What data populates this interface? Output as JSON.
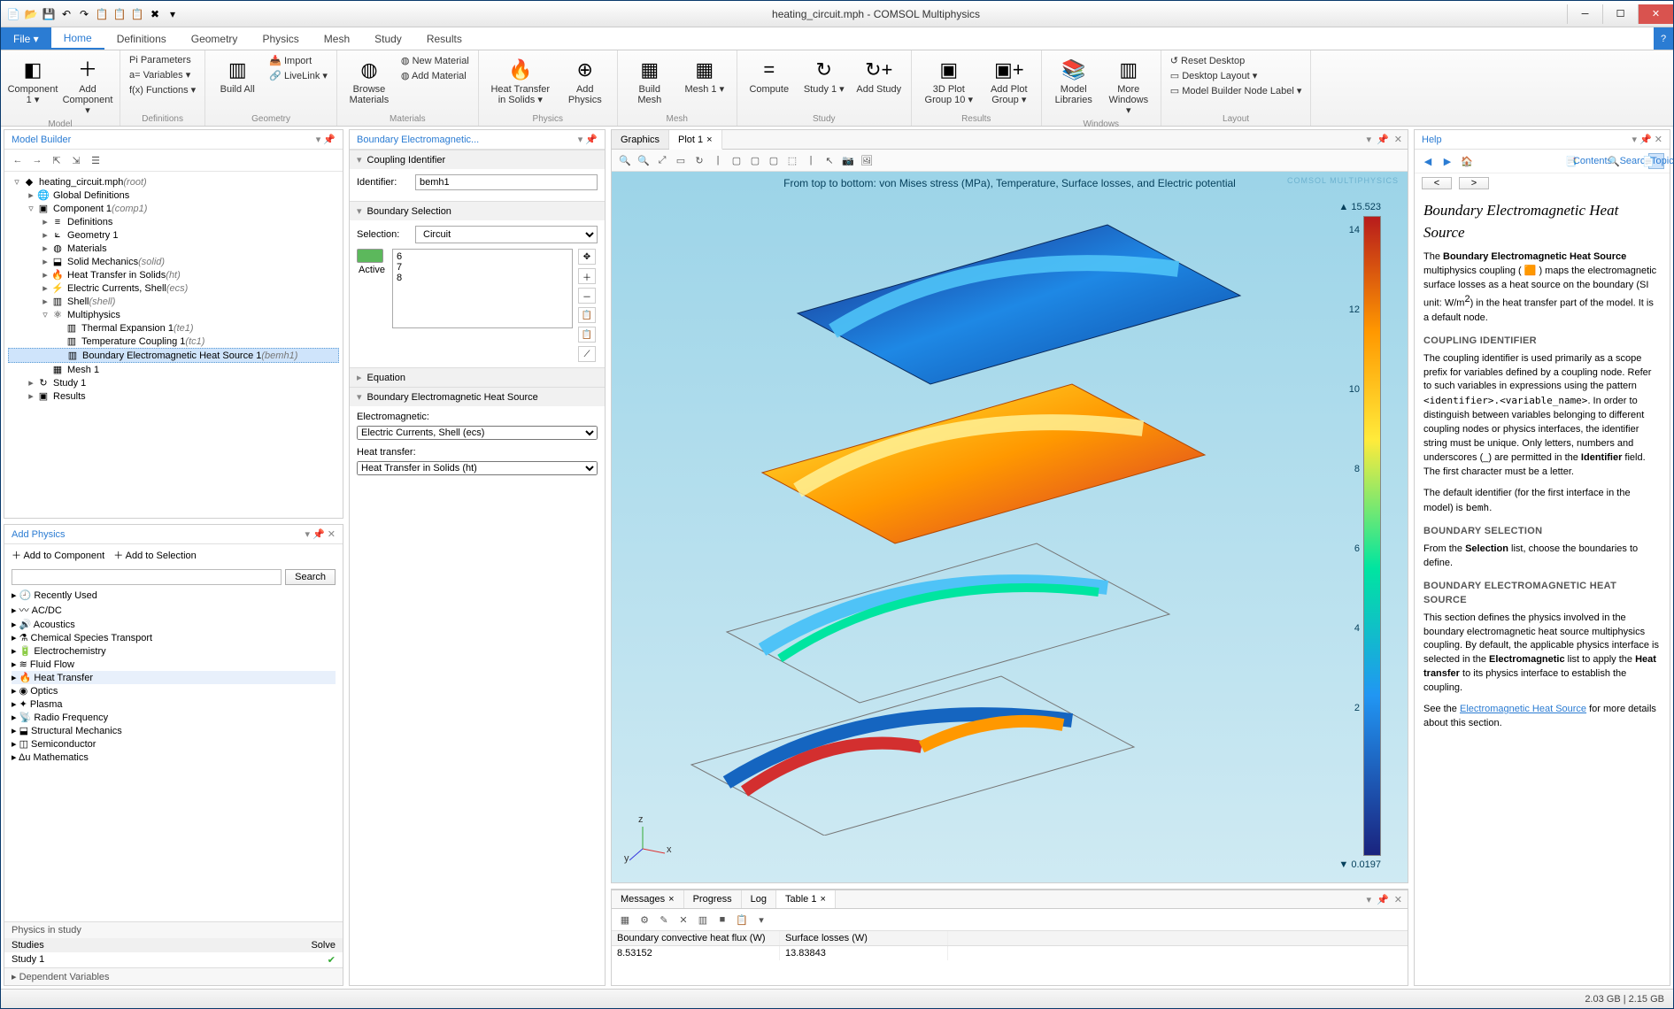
{
  "window": {
    "title": "heating_circuit.mph - COMSOL Multiphysics"
  },
  "qat": [
    "📄",
    "📂",
    "💾",
    "↶",
    "↷",
    "📋",
    "📋",
    "📋",
    "✖",
    "▾"
  ],
  "ribbon": {
    "file": "File ▾",
    "tabs": [
      "Home",
      "Definitions",
      "Geometry",
      "Physics",
      "Mesh",
      "Study",
      "Results"
    ],
    "groups": {
      "model": {
        "label": "Model",
        "btns": [
          {
            "lbl": "Component\n1 ▾",
            "ico": "◧"
          },
          {
            "lbl": "Add\nComponent ▾",
            "ico": "＋"
          }
        ]
      },
      "definitions": {
        "label": "Definitions",
        "stack": [
          "Pi Parameters",
          "a= Variables ▾",
          "f(x) Functions ▾"
        ]
      },
      "geometry": {
        "label": "Geometry",
        "btns": [
          {
            "lbl": "Build\nAll",
            "ico": "▥"
          }
        ],
        "stack": [
          "📥 Import",
          "🔗 LiveLink ▾"
        ]
      },
      "materials": {
        "label": "Materials",
        "btns": [
          {
            "lbl": "Browse\nMaterials",
            "ico": "◍"
          }
        ],
        "stack": [
          "◍ New Material",
          "◍ Add Material"
        ]
      },
      "physics": {
        "label": "Physics",
        "btns": [
          {
            "lbl": "Heat Transfer\nin Solids ▾",
            "ico": "🔥"
          },
          {
            "lbl": "Add\nPhysics",
            "ico": "⊕"
          }
        ]
      },
      "mesh": {
        "label": "Mesh",
        "btns": [
          {
            "lbl": "Build\nMesh",
            "ico": "▦"
          },
          {
            "lbl": "Mesh\n1 ▾",
            "ico": "▦"
          }
        ]
      },
      "study": {
        "label": "Study",
        "btns": [
          {
            "lbl": "Compute",
            "ico": "="
          },
          {
            "lbl": "Study\n1 ▾",
            "ico": "↻"
          },
          {
            "lbl": "Add\nStudy",
            "ico": "↻+"
          }
        ]
      },
      "results": {
        "label": "Results",
        "btns": [
          {
            "lbl": "3D Plot\nGroup 10 ▾",
            "ico": "▣"
          },
          {
            "lbl": "Add Plot\nGroup ▾",
            "ico": "▣+"
          }
        ]
      },
      "windows": {
        "label": "Windows",
        "btns": [
          {
            "lbl": "Model\nLibraries",
            "ico": "📚"
          },
          {
            "lbl": "More\nWindows ▾",
            "ico": "▥"
          }
        ]
      },
      "layout": {
        "label": "Layout",
        "stack": [
          "↺ Reset Desktop",
          "▭ Desktop Layout ▾",
          "▭ Model Builder Node Label ▾"
        ]
      }
    }
  },
  "modelBuilder": {
    "title": "Model Builder",
    "tree": [
      {
        "indent": 0,
        "tw": "▿",
        "ic": "◆",
        "txt": "heating_circuit.mph ",
        "em": "(root)"
      },
      {
        "indent": 1,
        "tw": "▸",
        "ic": "🌐",
        "txt": "Global Definitions"
      },
      {
        "indent": 1,
        "tw": "▿",
        "ic": "▣",
        "txt": "Component 1 ",
        "em": "(comp1)"
      },
      {
        "indent": 2,
        "tw": "▸",
        "ic": "≡",
        "txt": "Definitions"
      },
      {
        "indent": 2,
        "tw": "▸",
        "ic": "⟀",
        "txt": "Geometry 1"
      },
      {
        "indent": 2,
        "tw": "▸",
        "ic": "◍",
        "txt": "Materials"
      },
      {
        "indent": 2,
        "tw": "▸",
        "ic": "⬓",
        "txt": "Solid Mechanics ",
        "em": "(solid)"
      },
      {
        "indent": 2,
        "tw": "▸",
        "ic": "🔥",
        "txt": "Heat Transfer in Solids ",
        "em": "(ht)"
      },
      {
        "indent": 2,
        "tw": "▸",
        "ic": "⚡",
        "txt": "Electric Currents, Shell ",
        "em": "(ecs)"
      },
      {
        "indent": 2,
        "tw": "▸",
        "ic": "▥",
        "txt": "Shell ",
        "em": "(shell)"
      },
      {
        "indent": 2,
        "tw": "▿",
        "ic": "⚛",
        "txt": "Multiphysics"
      },
      {
        "indent": 3,
        "tw": "",
        "ic": "▥",
        "txt": "Thermal Expansion 1 ",
        "em": "(te1)"
      },
      {
        "indent": 3,
        "tw": "",
        "ic": "▥",
        "txt": "Temperature Coupling 1 ",
        "em": "(tc1)"
      },
      {
        "indent": 3,
        "tw": "",
        "ic": "▥",
        "txt": "Boundary Electromagnetic Heat Source 1 ",
        "em": "(bemh1)",
        "sel": true
      },
      {
        "indent": 2,
        "tw": "",
        "ic": "▦",
        "txt": "Mesh 1"
      },
      {
        "indent": 1,
        "tw": "▸",
        "ic": "↻",
        "txt": "Study 1"
      },
      {
        "indent": 1,
        "tw": "▸",
        "ic": "▣",
        "txt": "Results"
      }
    ]
  },
  "addPhysics": {
    "title": "Add Physics",
    "btns": [
      "＋ Add to Component",
      "＋ Add to Selection"
    ],
    "search": "Search",
    "items": [
      {
        "t": "Recently Used",
        "ic": "🕘"
      },
      {
        "t": "AC/DC",
        "ic": "〰"
      },
      {
        "t": "Acoustics",
        "ic": "🔊"
      },
      {
        "t": "Chemical Species Transport",
        "ic": "⚗"
      },
      {
        "t": "Electrochemistry",
        "ic": "🔋"
      },
      {
        "t": "Fluid Flow",
        "ic": "≋"
      },
      {
        "t": "Heat Transfer",
        "ic": "🔥",
        "sel": true
      },
      {
        "t": "Optics",
        "ic": "◉"
      },
      {
        "t": "Plasma",
        "ic": "✦"
      },
      {
        "t": "Radio Frequency",
        "ic": "📡"
      },
      {
        "t": "Structural Mechanics",
        "ic": "⬓"
      },
      {
        "t": "Semiconductor",
        "ic": "◫"
      },
      {
        "t": "Mathematics",
        "ic": "Δu"
      }
    ],
    "studiesHdr": "Physics in study",
    "col1": "Studies",
    "col2": "Solve",
    "row1": "Study 1",
    "row1b": "✔",
    "depvar": "Dependent Variables"
  },
  "settings": {
    "title": "Boundary Electromagnetic...",
    "sects": {
      "coupling": {
        "hdr": "Coupling Identifier",
        "idLbl": "Identifier:",
        "idVal": "bemh1"
      },
      "boundarySel": {
        "hdr": "Boundary Selection",
        "selLbl": "Selection:",
        "selVal": "Circuit",
        "activeLbl": "Active",
        "items": [
          "6",
          "7",
          "8"
        ]
      },
      "equation": {
        "hdr": "Equation"
      },
      "bemh": {
        "hdr": "Boundary Electromagnetic Heat Source",
        "emLbl": "Electromagnetic:",
        "emVal": "Electric Currents, Shell (ecs)",
        "htLbl": "Heat transfer:",
        "htVal": "Heat Transfer in Solids (ht)"
      }
    }
  },
  "graphics": {
    "tabs": [
      "Graphics",
      "Plot 1"
    ],
    "caption": "From top to bottom: von Mises stress (MPa), Temperature, Surface losses, and Electric potential",
    "logo": "COMSOL\nMULTIPHYSICS",
    "legend": {
      "max": "▲ 15.523",
      "min": "▼ 0.0197",
      "ticks": [
        "14",
        "12",
        "10",
        "8",
        "6",
        "4",
        "2"
      ]
    },
    "triad": {
      "x": "x",
      "y": "y",
      "z": "z"
    }
  },
  "bottom": {
    "tabs": [
      "Messages",
      "Progress",
      "Log",
      "Table 1"
    ],
    "table": {
      "h1": "Boundary convective heat flux (W)",
      "h2": "Surface losses (W)",
      "v1": "8.53152",
      "v2": "13.83843"
    }
  },
  "help": {
    "title": "Help",
    "nav": {
      "contents": "Contents",
      "search": "Search",
      "topic": "Topic"
    },
    "h2": "Boundary Electromagnetic Heat Source",
    "p1a": "The ",
    "p1b": "Boundary Electromagnetic Heat Source",
    "p1c": " multiphysics coupling ( 🟧 ) maps the electromagnetic surface losses as a heat source on the boundary (SI unit: W/m",
    "p1d": ") in the heat transfer part of the model. It is a default node.",
    "h3a": "COUPLING IDENTIFIER",
    "p2a": "The coupling identifier is used primarily as a scope prefix for variables defined by a coupling node. Refer to such variables in expressions using the pattern ",
    "p2code": "<identifier>.<variable_name>",
    "p2b": ". In order to distinguish between variables belonging to different coupling nodes or physics interfaces, the identifier string must be unique. Only letters, numbers and underscores (_) are permitted in the ",
    "p2c": "Identifier",
    "p2d": " field. The first character must be a letter.",
    "p3a": "The default identifier (for the first interface in the model) is ",
    "p3code": "bemh",
    "p3b": ".",
    "h3b": "BOUNDARY SELECTION",
    "p4a": "From the ",
    "p4b": "Selection",
    "p4c": " list, choose the boundaries to define.",
    "h3c": "BOUNDARY ELECTROMAGNETIC HEAT SOURCE",
    "p5a": "This section defines the physics involved in the boundary electromagnetic heat source multiphysics coupling. By default, the applicable physics interface is selected in the ",
    "p5b": "Electromagnetic",
    "p5c": " list to apply the ",
    "p5d": "Heat transfer",
    "p5e": " to its physics interface to establish the coupling.",
    "p6a": "See the ",
    "p6link": "Electromagnetic Heat Source",
    "p6b": " for more details about this section."
  },
  "status": "2.03 GB | 2.15 GB"
}
